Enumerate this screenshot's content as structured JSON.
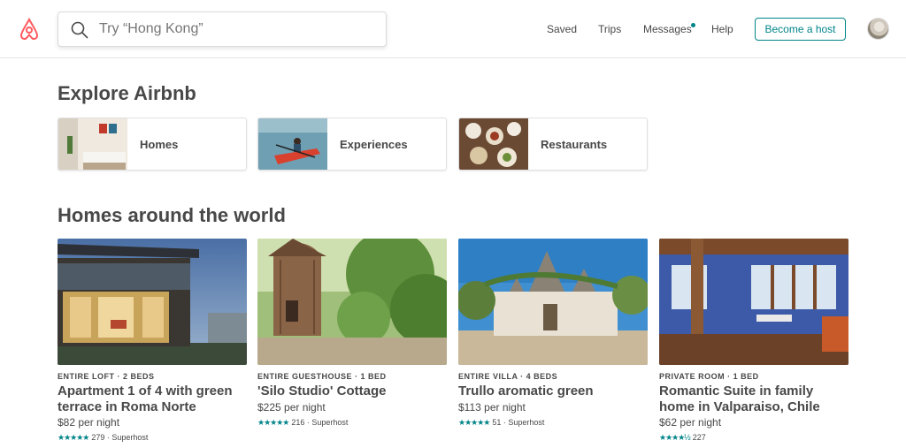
{
  "header": {
    "search_placeholder": "Try “Hong Kong”",
    "nav": [
      "Saved",
      "Trips",
      "Messages",
      "Help"
    ],
    "become_host": "Become a host"
  },
  "explore": {
    "title": "Explore Airbnb",
    "cards": [
      {
        "label": "Homes"
      },
      {
        "label": "Experiences"
      },
      {
        "label": "Restaurants"
      }
    ]
  },
  "homes": {
    "title": "Homes around the world",
    "listings": [
      {
        "type": "ENTIRE LOFT · 2 BEDS",
        "title": "Apartment 1 of 4 with green terrace in Roma Norte",
        "price": "$82 per night",
        "stars": "★★★★★",
        "rating": "279 · Superhost"
      },
      {
        "type": "ENTIRE GUESTHOUSE · 1 BED",
        "title": "'Silo Studio' Cottage",
        "price": "$225 per night",
        "stars": "★★★★★",
        "rating": "216 · Superhost"
      },
      {
        "type": "ENTIRE VILLA · 4 BEDS",
        "title": "Trullo aromatic green",
        "price": "$113 per night",
        "stars": "★★★★★",
        "rating": "51 · Superhost"
      },
      {
        "type": "PRIVATE ROOM · 1 BED",
        "title": "Romantic Suite in family home in Valparaiso, Chile",
        "price": "$62 per night",
        "stars": "★★★★½",
        "rating": "227"
      }
    ]
  },
  "colors": {
    "brand": "#FF5A5F",
    "accent": "#008489",
    "text": "#484848"
  },
  "icons": {
    "logo": "airbnb-logo",
    "search": "search-icon"
  }
}
